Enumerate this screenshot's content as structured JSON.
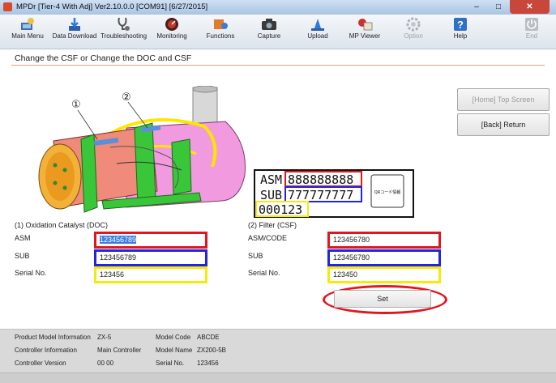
{
  "window": {
    "title": "MPDr [Tier-4 With Adj] Ver2.10.0.0 [COM91] [6/27/2015]",
    "minimize": "–",
    "maximize": "□",
    "close": "✕"
  },
  "toolbar": {
    "items": [
      {
        "label": "Main Menu",
        "icon": "main-menu-icon",
        "enabled": true
      },
      {
        "label": "Data Download",
        "icon": "data-download-icon",
        "enabled": true
      },
      {
        "label": "Troubleshooting",
        "icon": "troubleshooting-icon",
        "enabled": true
      },
      {
        "label": "Monitoring",
        "icon": "monitoring-icon",
        "enabled": true
      },
      {
        "label": "Functions",
        "icon": "functions-icon",
        "enabled": true
      },
      {
        "label": "Capture",
        "icon": "camera-icon",
        "enabled": true
      },
      {
        "label": "Upload",
        "icon": "upload-icon",
        "enabled": true
      },
      {
        "label": "MP Viewer",
        "icon": "mp-viewer-icon",
        "enabled": true
      },
      {
        "label": "Option",
        "icon": "option-icon",
        "enabled": false
      },
      {
        "label": "Help",
        "icon": "help-icon",
        "enabled": true
      },
      {
        "label": "End",
        "icon": "power-icon",
        "enabled": false
      }
    ]
  },
  "page": {
    "title": "Change the CSF or Change the DOC and CSF"
  },
  "diagram": {
    "callout_1": "①",
    "callout_2": "②",
    "label_asm": "ASM",
    "asm_code": "888888888",
    "label_sub": "SUB",
    "sub_code": "777777777",
    "serial": "000123",
    "qr_label": "QRコード情報"
  },
  "side": {
    "home": "[Home] Top Screen",
    "back": "[Back] Return"
  },
  "doc": {
    "header": "(1) Oxidation Catalyst (DOC)",
    "asm_label": "ASM",
    "asm_value": "123456789",
    "sub_label": "SUB",
    "sub_value": "123456789",
    "serial_label": "Serial No.",
    "serial_value": "123456"
  },
  "csf": {
    "header": "(2) Filter (CSF)",
    "asm_label": "ASM/CODE",
    "asm_value": "123456780",
    "sub_label": "SUB",
    "sub_value": "123456780",
    "serial_label": "Serial No.",
    "serial_value": "123450"
  },
  "set_label": "Set",
  "colors": {
    "asm_border": "#e3161f",
    "sub_border": "#2224e0",
    "serial_border": "#f5e90d",
    "highlight": "#e3161f"
  },
  "footer": {
    "product_model_label": "Product Model Information",
    "product_model_value": "ZX-5",
    "model_code_label": "Model Code",
    "model_code_value": "ABCDE",
    "controller_info_label": "Controller Information",
    "controller_info_value": "Main Controller",
    "model_name_label": "Model Name",
    "model_name_value": "ZX200-5B",
    "controller_version_label": "Controller Version",
    "controller_version_value": "00 00",
    "serial_label": "Serial No.",
    "serial_value": "123456"
  }
}
